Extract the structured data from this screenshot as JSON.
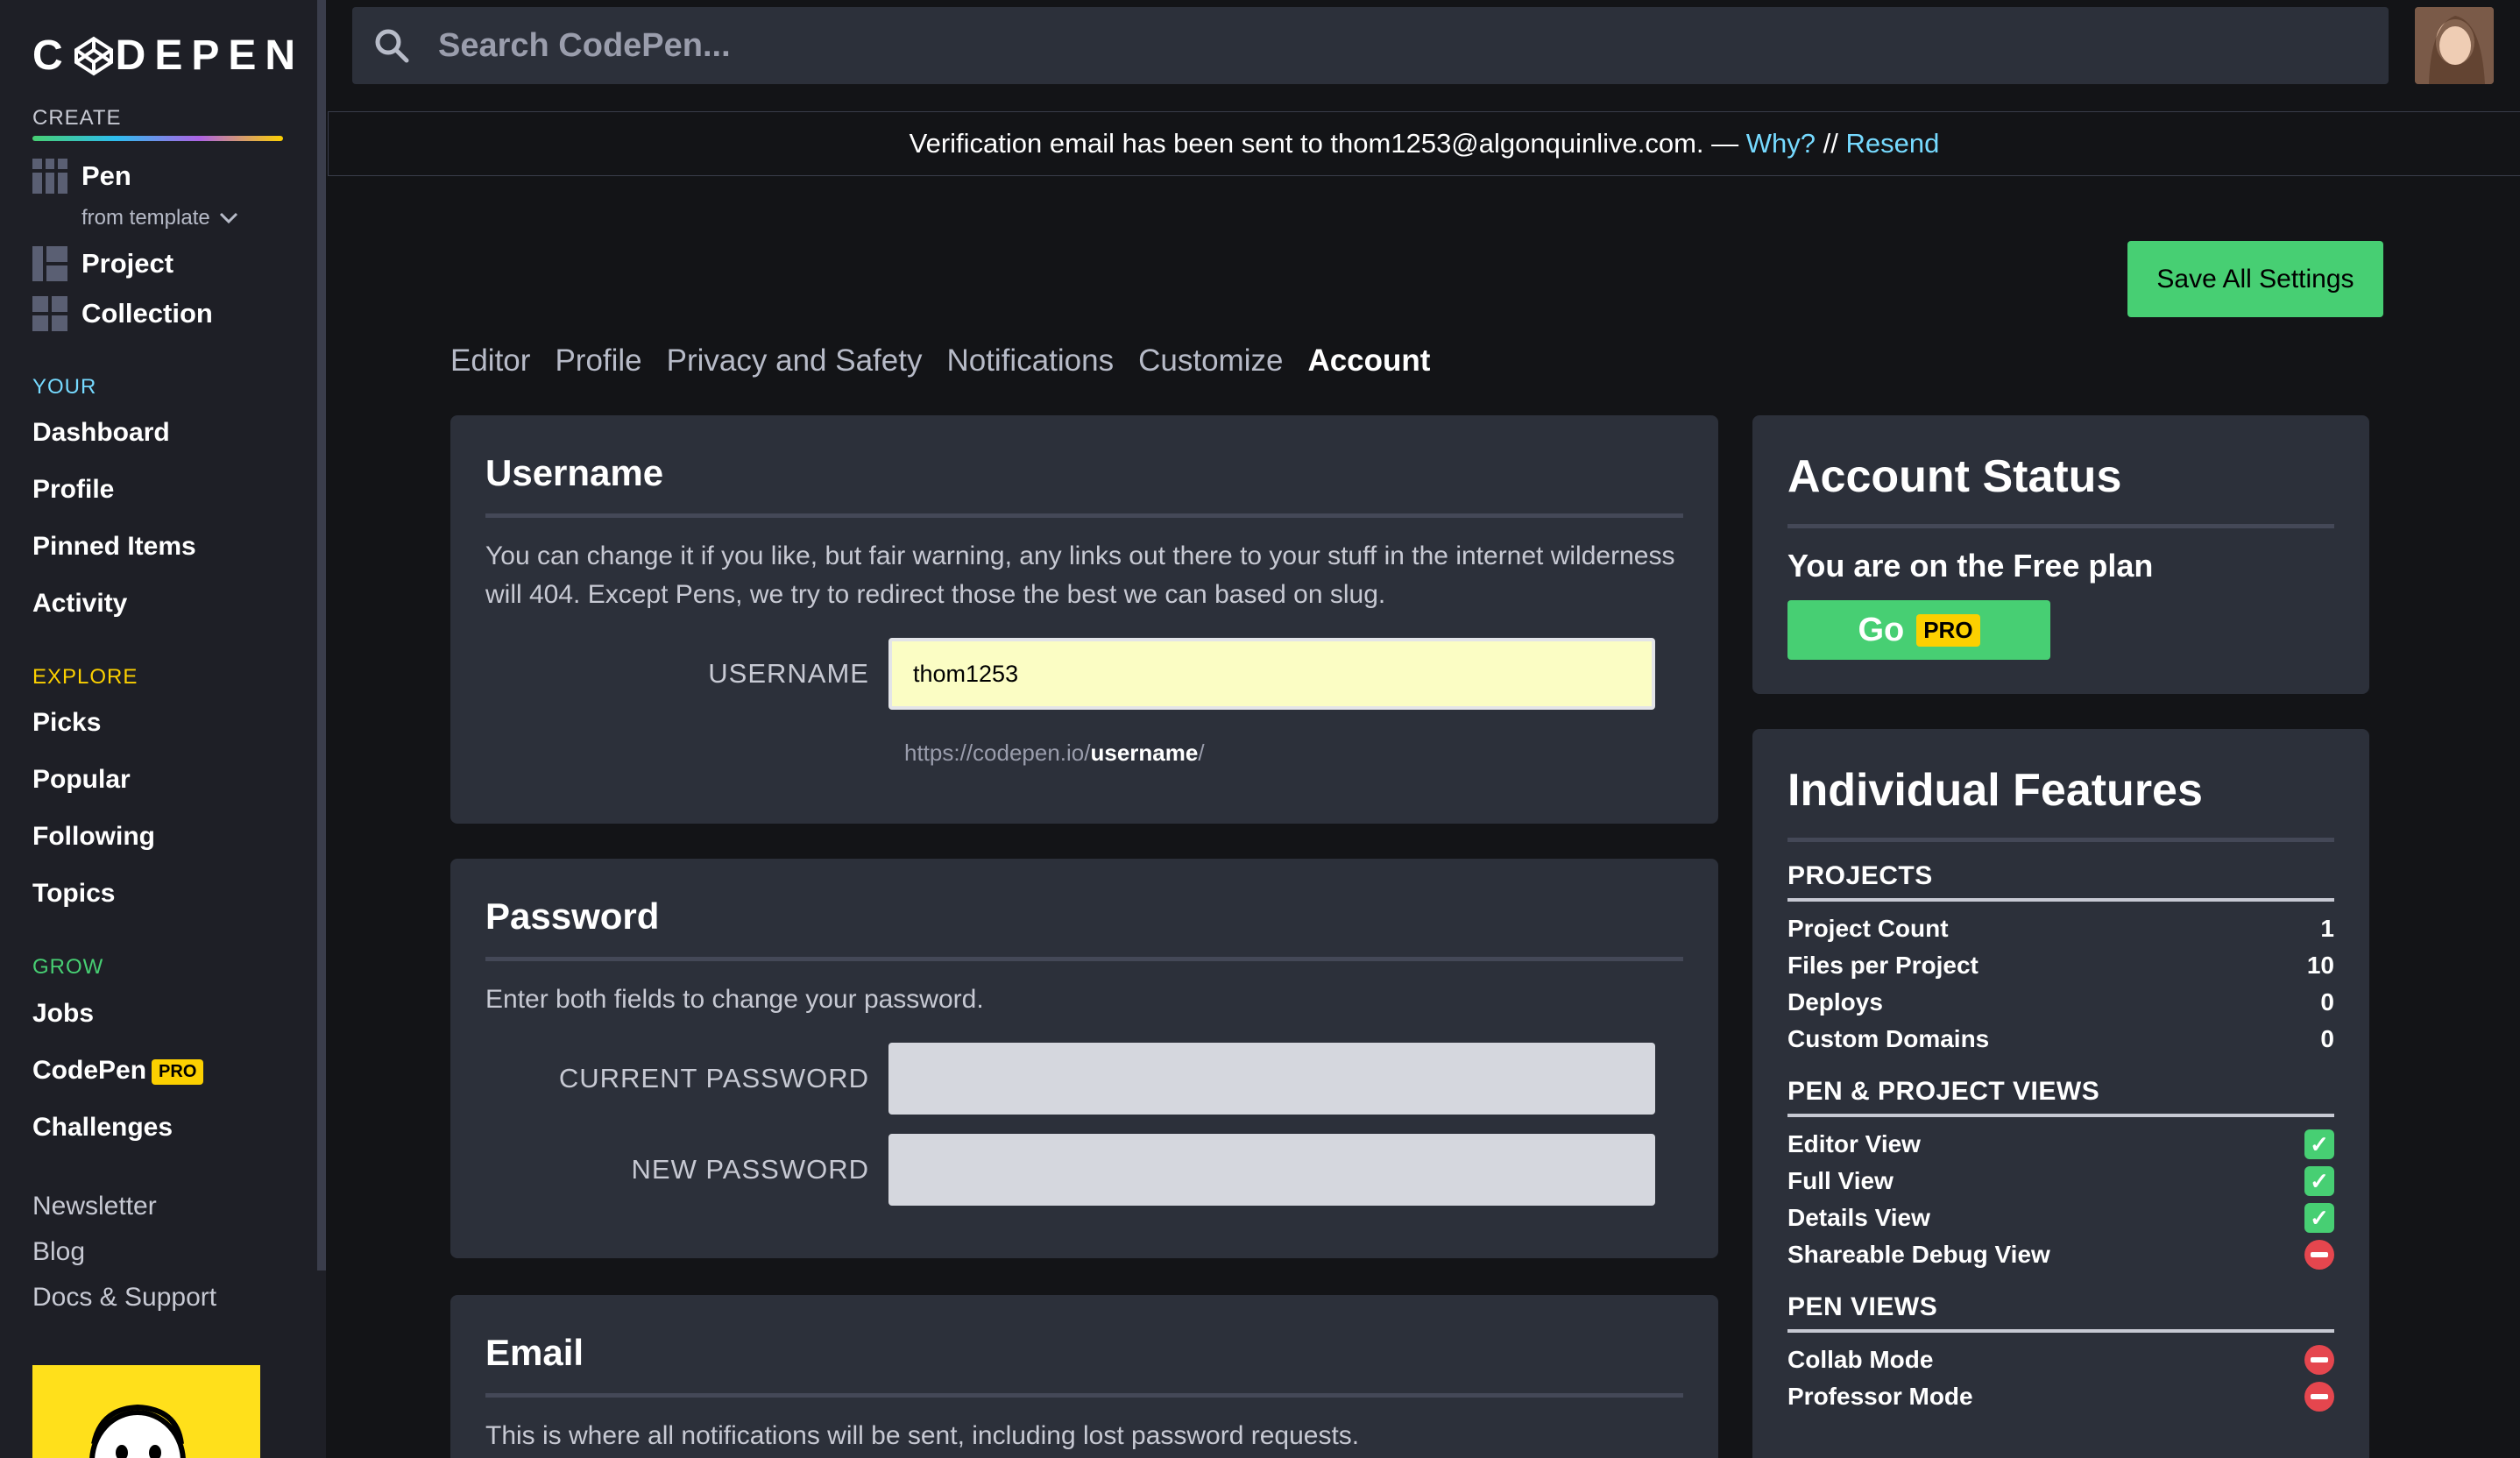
{
  "sidebar": {
    "logo": "CODEPEN",
    "create_label": "CREATE",
    "create_items": [
      {
        "label": "Pen",
        "icon": "pen-grid-icon"
      },
      {
        "label": "Project",
        "icon": "project-grid-icon"
      },
      {
        "label": "Collection",
        "icon": "collection-grid-icon"
      }
    ],
    "from_template": "from template",
    "your_label": "YOUR",
    "your_items": [
      "Dashboard",
      "Profile",
      "Pinned Items",
      "Activity"
    ],
    "explore_label": "EXPLORE",
    "explore_items": [
      "Picks",
      "Popular",
      "Following",
      "Topics"
    ],
    "grow_label": "GROW",
    "grow_items": [
      "Jobs",
      "CodePen",
      "Challenges"
    ],
    "pro_badge": "PRO",
    "footer_links": [
      "Newsletter",
      "Blog",
      "Docs & Support"
    ],
    "colors": {
      "your": "#76daff",
      "explore": "#fcd000",
      "grow": "#47cf73"
    }
  },
  "search": {
    "placeholder": "Search CodePen..."
  },
  "banner": {
    "text": "Verification email has been sent to thom1253@algonquinlive.com. — ",
    "why": "Why?",
    "sep": " // ",
    "resend": "Resend"
  },
  "save_button": "Save All Settings",
  "tabs": [
    "Editor",
    "Profile",
    "Privacy and Safety",
    "Notifications",
    "Customize",
    "Account"
  ],
  "active_tab": "Account",
  "username_panel": {
    "title": "Username",
    "desc": "You can change it if you like, but fair warning, any links out there to your stuff in the internet wilderness will 404. Except Pens, we try to redirect those the best we can based on slug.",
    "label": "USERNAME",
    "value": "thom1253",
    "url_prefix": "https://codepen.io/",
    "url_bold": "username",
    "url_suffix": "/"
  },
  "password_panel": {
    "title": "Password",
    "desc": "Enter both fields to change your password.",
    "current_label": "CURRENT PASSWORD",
    "new_label": "NEW PASSWORD"
  },
  "email_panel": {
    "title": "Email",
    "desc": "This is where all notifications will be sent, including lost password requests."
  },
  "account_status": {
    "title": "Account Status",
    "plan_text": "You are on the Free plan",
    "go_label": "Go",
    "pro_label": "PRO"
  },
  "features": {
    "title": "Individual Features",
    "groups": [
      {
        "heading": "PROJECTS",
        "rows": [
          {
            "label": "Project Count",
            "value": "1"
          },
          {
            "label": "Files per Project",
            "value": "10"
          },
          {
            "label": "Deploys",
            "value": "0"
          },
          {
            "label": "Custom Domains",
            "value": "0"
          }
        ]
      },
      {
        "heading": "PEN & PROJECT VIEWS",
        "rows": [
          {
            "label": "Editor View",
            "status": "yes"
          },
          {
            "label": "Full View",
            "status": "yes"
          },
          {
            "label": "Details View",
            "status": "yes"
          },
          {
            "label": "Shareable Debug View",
            "status": "no"
          }
        ]
      },
      {
        "heading": "PEN VIEWS",
        "rows": [
          {
            "label": "Collab Mode",
            "status": "no"
          },
          {
            "label": "Professor Mode",
            "status": "no"
          }
        ]
      }
    ]
  }
}
